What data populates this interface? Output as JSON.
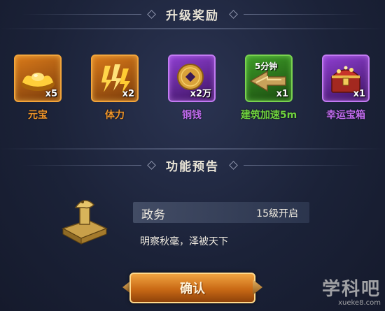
{
  "upgrade_rewards": {
    "title": "升级奖励",
    "items": [
      {
        "name": "元宝",
        "qty": "x5",
        "color": "#f0952a",
        "frame": "orange",
        "icon": "gold-ingot-icon"
      },
      {
        "name": "体力",
        "qty": "x2",
        "color": "#f0952a",
        "frame": "orange",
        "icon": "stamina-icon"
      },
      {
        "name": "铜钱",
        "qty": "x2万",
        "color": "#c16cf0",
        "frame": "purple",
        "icon": "copper-coin-icon"
      },
      {
        "name": "建筑加速5m",
        "qty": "x1",
        "color": "#6fd13f",
        "frame": "green",
        "icon": "speedup-icon",
        "badge": "5分钟"
      },
      {
        "name": "幸运宝箱",
        "qty": "x1",
        "color": "#c16cf0",
        "frame": "purple",
        "icon": "treasure-chest-icon"
      }
    ]
  },
  "feature_preview": {
    "title": "功能预告",
    "name": "政务",
    "unlock_level": "15级开启",
    "description": "明察秋毫，泽被天下",
    "icon": "government-seal-icon"
  },
  "confirm_button": {
    "label": "确认"
  },
  "watermark": {
    "brand": "学科吧",
    "url": "xueke8.com"
  }
}
